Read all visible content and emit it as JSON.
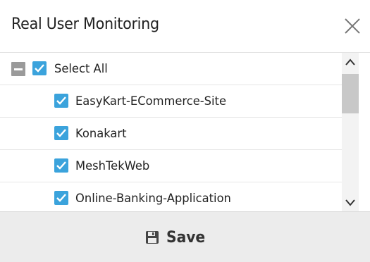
{
  "dialog": {
    "title": "Real User Monitoring",
    "close_icon": "close-icon"
  },
  "list": {
    "select_all": {
      "label": "Select All",
      "checked": true,
      "collapse_icon": "minus-square-icon"
    },
    "items": [
      {
        "label": "EasyKart-ECommerce-Site",
        "checked": true
      },
      {
        "label": "Konakart",
        "checked": true
      },
      {
        "label": "MeshTekWeb",
        "checked": true
      },
      {
        "label": "Online-Banking-Application",
        "checked": true
      }
    ]
  },
  "scrollbar": {
    "up_icon": "chevron-up-icon",
    "down_icon": "chevron-down-icon"
  },
  "footer": {
    "save_label": "Save",
    "save_icon": "floppy-disk-icon"
  },
  "colors": {
    "checkbox": "#3ba3dc",
    "footer_bg": "#ececec",
    "collapse": "#9a9a9a"
  }
}
